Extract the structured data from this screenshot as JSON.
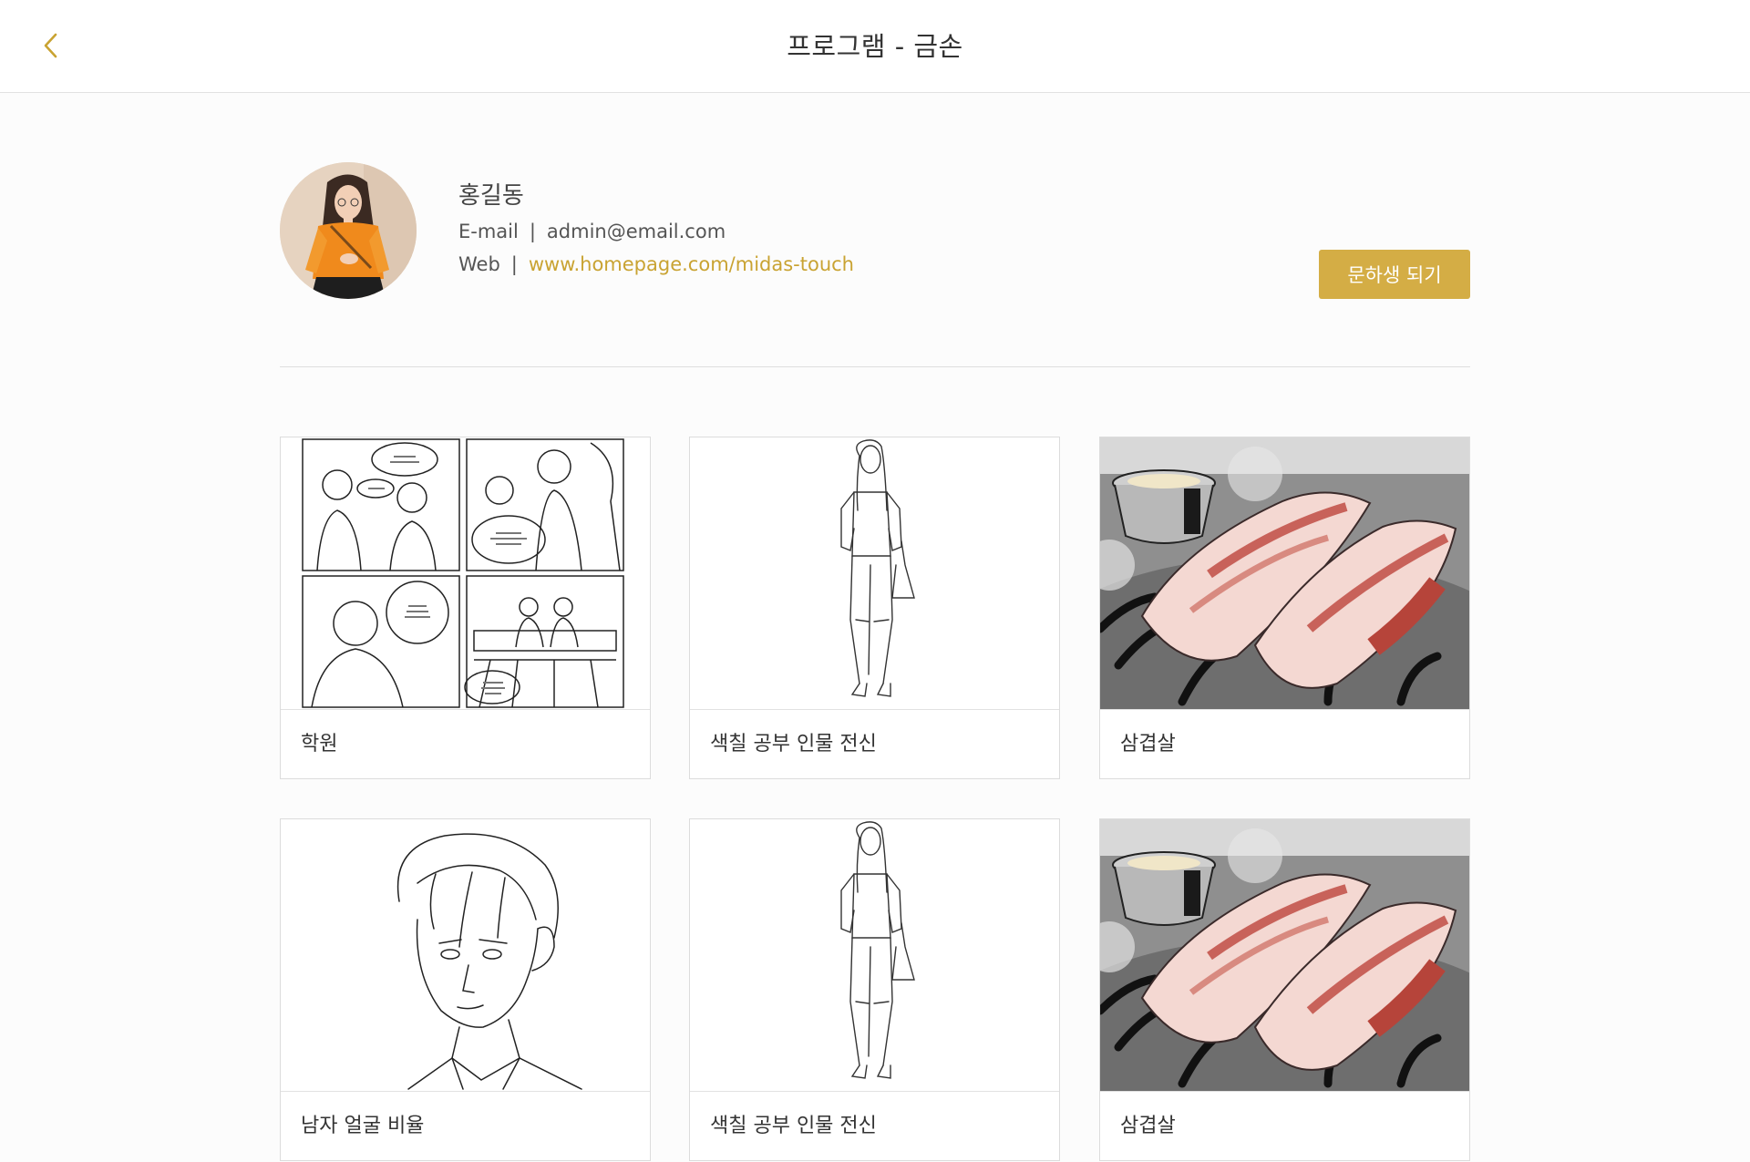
{
  "header": {
    "title": "프로그램 - 금손",
    "back_icon": "chevron-left-icon",
    "accent_color": "#c9a332"
  },
  "profile": {
    "name": "홍길동",
    "email_label": "E-mail",
    "email": "admin@email.com",
    "web_label": "Web",
    "web": "www.homepage.com/midas-touch",
    "separator": "|",
    "cta_label": "문하생 되기",
    "cta_color": "#d4ad45"
  },
  "gallery": {
    "items": [
      {
        "label": "학원",
        "image": "comic-panels"
      },
      {
        "label": "색칠 공부 인물 전신",
        "image": "full-body-sketch"
      },
      {
        "label": "삼겹살",
        "image": "pork-belly"
      },
      {
        "label": "남자 얼굴 비율",
        "image": "male-face-sketch"
      },
      {
        "label": "색칠 공부 인물 전신",
        "image": "full-body-sketch"
      },
      {
        "label": "삼겹살",
        "image": "pork-belly"
      }
    ]
  }
}
